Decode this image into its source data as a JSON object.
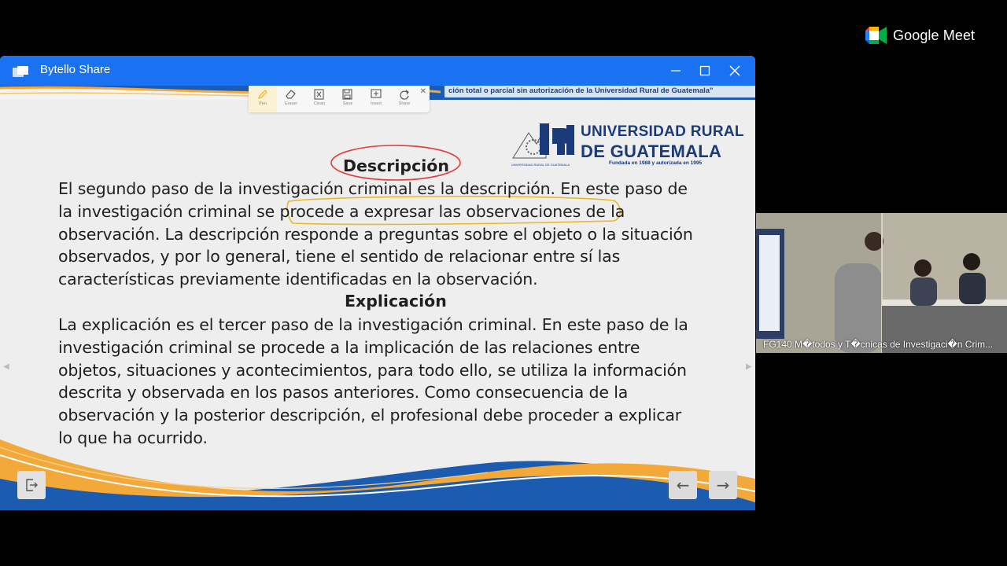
{
  "meet": {
    "brand": "Google Meet",
    "participant_caption": "FG140 M�todos y T�cnicas de Investigaci�n Crim..."
  },
  "window": {
    "title": "Bytello Share",
    "controls": {
      "minimize": "—",
      "maximize": "□",
      "close": "✕"
    }
  },
  "toolbar": {
    "tools": [
      {
        "label": "Pen",
        "icon": "pen-icon"
      },
      {
        "label": "Eraser",
        "icon": "eraser-icon"
      },
      {
        "label": "Clean",
        "icon": "clean-icon"
      },
      {
        "label": "Save",
        "icon": "save-icon"
      },
      {
        "label": "Insert",
        "icon": "insert-icon"
      },
      {
        "label": "Share",
        "icon": "share-icon"
      }
    ],
    "close": "✕"
  },
  "slide": {
    "copyright": "ción total o parcial sin autorización de la Universidad Rural de Guatemala\"",
    "logo": {
      "line1": "UNIVERSIDAD RURAL",
      "line2": "DE GUATEMALA",
      "tagline": "Fundada en 1988 y autorizada en 1995",
      "small": "UNIVERSIDAD RURAL DE GUATEMALA"
    },
    "heading1": "Descripción",
    "paragraph1": [
      "El segundo paso de la investigación criminal es la descripción. En este paso de",
      "la investigación criminal se procede a expresar las observaciones de la",
      "observación. La descripción responde a preguntas sobre el objeto o la situación",
      "observados, y por lo general, tiene el sentido de relacionar entre sí las",
      "características previamente identificadas en la observación."
    ],
    "heading2": "Explicación",
    "paragraph2": [
      "La explicación es el tercer paso de la investigación criminal. En este paso de la",
      "investigación criminal se procede a la implicación de las relaciones entre",
      "objetos, situaciones y acontecimientos, para todo ello, se utiliza la información",
      "descrita y observada en los pasos anteriores. Como consecuencia de la",
      "observación y la posterior descripción, el profesional debe proceder a explicar",
      "lo que ha ocurrido."
    ],
    "nav": {
      "prev": "←",
      "next": "→",
      "exit_icon": "exit-icon"
    }
  },
  "colors": {
    "titlebar": "#1a72f2",
    "annotation_red": "#e23b3b",
    "annotation_yellow": "#e8b92a",
    "brand_blue": "#1b3a7a",
    "wave_orange": "#f3a93a"
  }
}
